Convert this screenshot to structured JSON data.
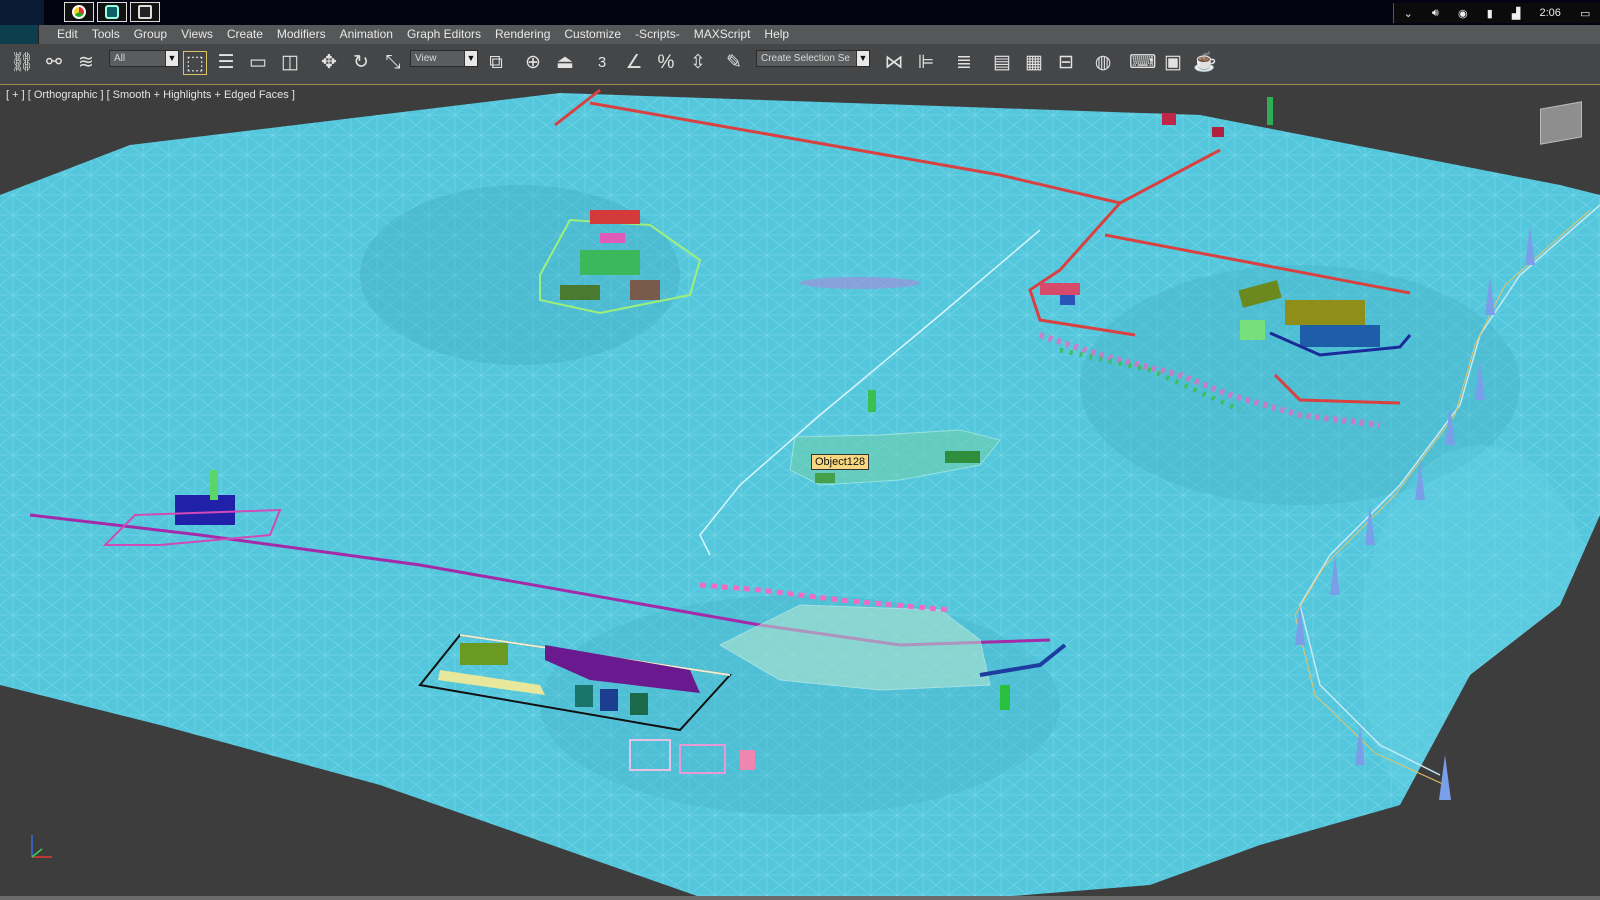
{
  "taskbar": {
    "apps": [
      {
        "icon": "chrome-icon"
      },
      {
        "icon": "3dsmax-app-icon"
      },
      {
        "icon": "camera-app-icon"
      }
    ],
    "tray": {
      "icons": [
        "chevron-down-icon",
        "speaker-icon",
        "network-icon",
        "battery-icon",
        "signal-icon"
      ],
      "time": "2:06"
    }
  },
  "menu": {
    "items": [
      "Edit",
      "Tools",
      "Group",
      "Views",
      "Create",
      "Modifiers",
      "Animation",
      "Graph Editors",
      "Rendering",
      "Customize",
      "-Scripts-",
      "MAXScript",
      "Help"
    ]
  },
  "toolbar": {
    "selection_filter": "All",
    "reference_coord": "View",
    "snap_label": "3",
    "named_selection_placeholder": "Create Selection Se"
  },
  "viewport": {
    "label": "[ + ] [ Orthographic ] [ Smooth + Highlights + Edged Faces ]",
    "tooltip": "Object128",
    "background_color": "#3d3d3d",
    "mesh_fill": "#55c7dc",
    "wire_color": "#8fe4f2"
  }
}
